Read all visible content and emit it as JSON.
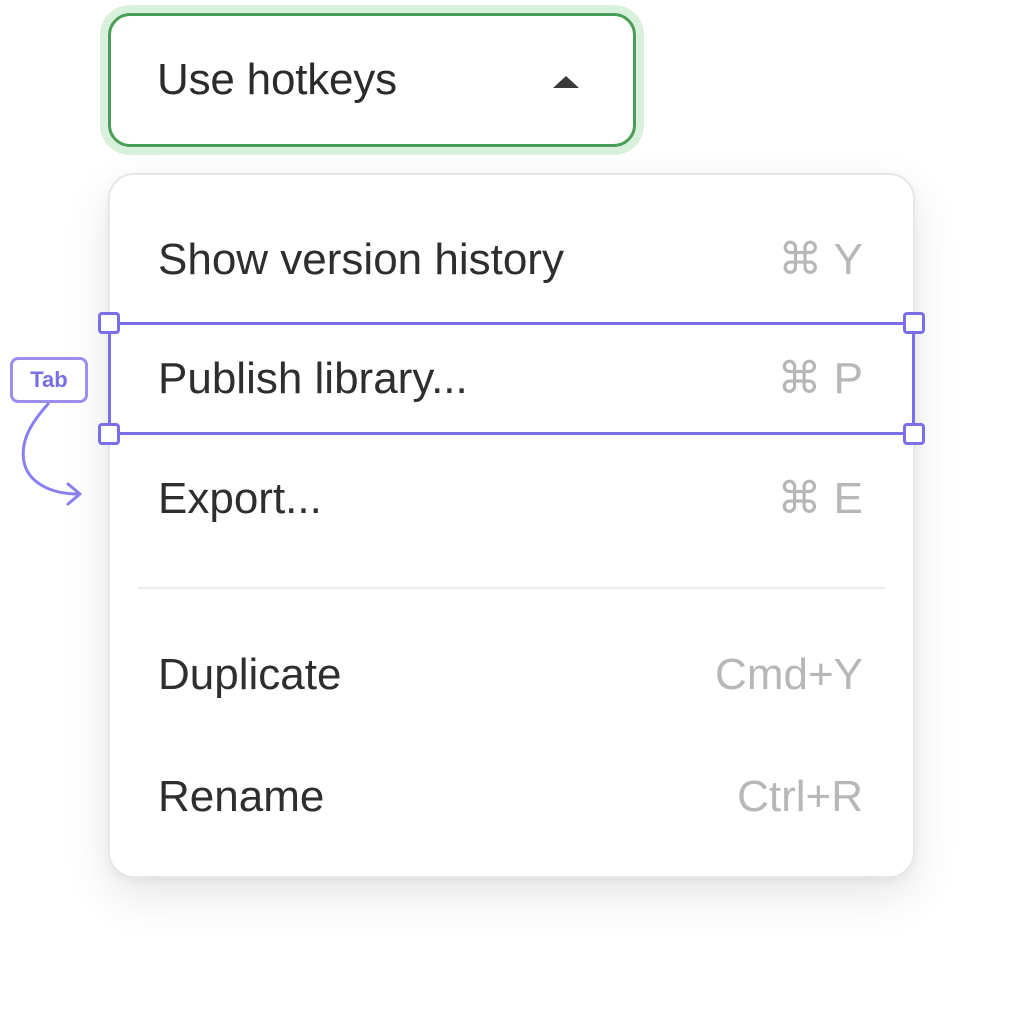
{
  "trigger": {
    "label": "Use hotkeys",
    "icon": "caret-up-icon",
    "accent_color": "#4a9e55"
  },
  "menu": {
    "items": [
      {
        "label": "Show version history",
        "shortcut": "⌘ Y"
      },
      {
        "label": "Publish library...",
        "shortcut": "⌘ P",
        "focused": true
      },
      {
        "label": "Export...",
        "shortcut": "⌘ E"
      },
      {
        "label": "Duplicate",
        "shortcut": "Cmd+Y"
      },
      {
        "label": "Rename",
        "shortcut": "Ctrl+R"
      }
    ]
  },
  "focus_indicator": {
    "badge_label": "Tab",
    "color": "#7b6ee6",
    "icon": "curved-arrow-icon"
  }
}
